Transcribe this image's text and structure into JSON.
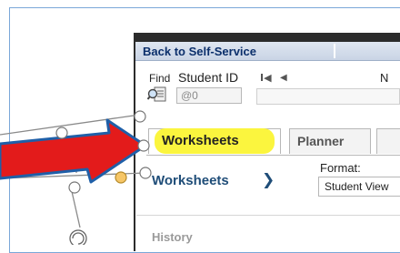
{
  "nav": {
    "back_label": "Back to Self-Service"
  },
  "search": {
    "find_label": "Find",
    "student_id_label": "Student ID",
    "student_id_value": "@0",
    "pager_first_glyph": "I◀",
    "pager_prev_glyph": "◀",
    "pager_next_partial": "N"
  },
  "tabs": [
    {
      "label": "Worksheets",
      "active": true,
      "highlighted": true
    },
    {
      "label": "Planner",
      "active": false
    }
  ],
  "worksheets": {
    "heading": "Worksheets",
    "chevron": "❯",
    "format_label": "Format:",
    "format_value": "Student View"
  },
  "history_label": "History",
  "colors": {
    "highlight": "#fbf53e",
    "arrow_fill": "#e31b1b",
    "arrow_outline": "#1f5fa8",
    "heading_blue": "#1f4d78"
  },
  "icons": [
    "find-magnifier-icon",
    "chevron-right-icon",
    "arrow-annotation"
  ]
}
